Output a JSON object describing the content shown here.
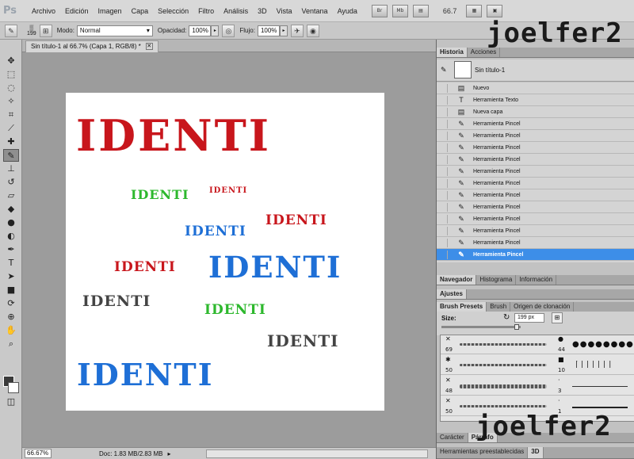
{
  "app": {
    "logo": "Ps",
    "watermark": "joelfer2"
  },
  "menu": [
    "Archivo",
    "Edición",
    "Imagen",
    "Capa",
    "Selección",
    "Filtro",
    "Análisis",
    "3D",
    "Vista",
    "Ventana",
    "Ayuda"
  ],
  "menubar_buttons": [
    "Br",
    "Mb"
  ],
  "zoom_display": "66.7",
  "options": {
    "brush_size": "199",
    "mode_label": "Modo:",
    "mode_value": "Normal",
    "opacity_label": "Opacidad:",
    "opacity_value": "100%",
    "flow_label": "Flujo:",
    "flow_value": "100%"
  },
  "document": {
    "tab_title": "Sin título-1 al 66.7% (Capa 1, RGB/8) *",
    "close_glyph": "✕"
  },
  "canvas_texts": [
    {
      "text": "IDENTI",
      "color": "#c8161c"
    },
    {
      "text": "IDENTI",
      "color": "#2db82d"
    },
    {
      "text": "IDENTI",
      "color": "#c8161c"
    },
    {
      "text": "IDENTI",
      "color": "#c8161c"
    },
    {
      "text": "IDENTI",
      "color": "#1e6fd6"
    },
    {
      "text": "IDENTI",
      "color": "#c8161c"
    },
    {
      "text": "IDENTI",
      "color": "#1e6fd6"
    },
    {
      "text": "IDENTI",
      "color": "#444444"
    },
    {
      "text": "IDENTI",
      "color": "#2db82d"
    },
    {
      "text": "IDENTI",
      "color": "#444444"
    },
    {
      "text": "IDENTI",
      "color": "#1e6fd6"
    }
  ],
  "status": {
    "zoom": "66.67%",
    "doc": "Doc: 1.83 MB/2.83 MB"
  },
  "history_panel": {
    "tabs": [
      "Historia",
      "Acciones"
    ],
    "snapshot": "Sin título-1",
    "rows": [
      {
        "label": "Nuevo",
        "icon": "document-icon"
      },
      {
        "label": "Herramienta Texto",
        "icon": "text-icon"
      },
      {
        "label": "Nueva capa",
        "icon": "document-icon"
      },
      {
        "label": "Herramienta Pincel",
        "icon": "brush-icon"
      },
      {
        "label": "Herramienta Pincel",
        "icon": "brush-icon"
      },
      {
        "label": "Herramienta Pincel",
        "icon": "brush-icon"
      },
      {
        "label": "Herramienta Pincel",
        "icon": "brush-icon"
      },
      {
        "label": "Herramienta Pincel",
        "icon": "brush-icon"
      },
      {
        "label": "Herramienta Pincel",
        "icon": "brush-icon"
      },
      {
        "label": "Herramienta Pincel",
        "icon": "brush-icon"
      },
      {
        "label": "Herramienta Pincel",
        "icon": "brush-icon"
      },
      {
        "label": "Herramienta Pincel",
        "icon": "brush-icon"
      },
      {
        "label": "Herramienta Pincel",
        "icon": "brush-icon"
      },
      {
        "label": "Herramienta Pincel",
        "icon": "brush-icon"
      },
      {
        "label": "Herramienta Pincel",
        "icon": "brush-icon",
        "selected": true
      }
    ]
  },
  "navigator_tabs": [
    "Navegador",
    "Histograma",
    "Información"
  ],
  "adjust_tab": "Ajustes",
  "brush_tabs": [
    "Brush Presets",
    "Brush",
    "Origen de clonación"
  ],
  "brush_size": {
    "label": "Size:",
    "value": "199 px"
  },
  "brush_presets": [
    {
      "left": "69",
      "right": "44"
    },
    {
      "left": "50",
      "right": "10"
    },
    {
      "left": "48",
      "right": "3"
    },
    {
      "left": "50",
      "right": "1"
    }
  ],
  "char_tabs": [
    "Carácter",
    "Párrafo"
  ],
  "bottom_tabs": [
    "Herramientas preestablecidas",
    "3D"
  ]
}
